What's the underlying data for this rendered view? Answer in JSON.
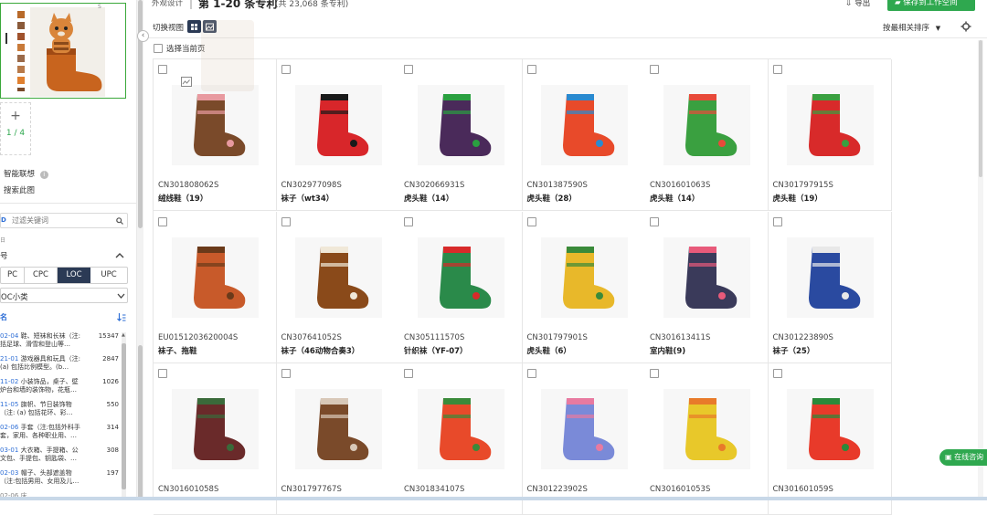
{
  "header": {
    "section": "外观设计",
    "range_title": "第 1-20 条专利",
    "total": "(共 23,068 条专利)",
    "export_label": "导出",
    "save_label": "保存到工作空间"
  },
  "toolbar": {
    "switch_view_label": "切换视图",
    "select_page_label": "选择当前页",
    "sort_label": "按最相关排序"
  },
  "left": {
    "page_indicator": "1 / 4",
    "smart_assoc_label": "智能联想",
    "search_image_label": "搜索此图",
    "filter_placeholder": "过滤关键词",
    "group_label": "号",
    "tabs": [
      "PC",
      "CPC",
      "LOC",
      "UPC"
    ],
    "active_tab": "LOC",
    "select_value": "OC小类",
    "sort_label": "名",
    "classes": [
      {
        "code": "02-04",
        "name": "鞋、短袜和长袜（注:",
        "sub": "括足球、滑雪和登山等…",
        "count": "15347"
      },
      {
        "code": "21-01",
        "name": "游戏器具和玩具（注:",
        "sub": "(a) 包括比例模型。(b…",
        "count": "2847"
      },
      {
        "code": "11-02",
        "name": "小装饰品，桌子、壁",
        "sub": "炉台和墙的装饰物，花瓶…",
        "count": "1026"
      },
      {
        "code": "11-05",
        "name": "旗帜、节日装饰物",
        "sub": "（注: (a) 包括花环、彩…",
        "count": "550"
      },
      {
        "code": "02-06",
        "name": "手套（注:包括外科手",
        "sub": "套，家用、各种职业用、…",
        "count": "314"
      },
      {
        "code": "03-01",
        "name": "大衣箱、手提箱、公",
        "sub": "文包、手提包、钥匙袋、…",
        "count": "308"
      },
      {
        "code": "02-03",
        "name": "帽子、头部遮盖物",
        "sub": "（注:包括男用、女用及儿…",
        "count": "197"
      }
    ]
  },
  "cards": [
    {
      "id": "CN301808062S",
      "name": "绒线鞋（19）",
      "color": "#7a4a2a",
      "accent": "#e89aa0"
    },
    {
      "id": "CN302977098S",
      "name": "袜子（wt34）",
      "color": "#d8262a",
      "accent": "#1a1a1a"
    },
    {
      "id": "CN302066931S",
      "name": "虎头鞋（14）",
      "color": "#4a2a5a",
      "accent": "#2aa040"
    },
    {
      "id": "CN301387590S",
      "name": "虎头鞋（28）",
      "color": "#e84a2a",
      "accent": "#2a8ad0"
    },
    {
      "id": "CN301601063S",
      "name": "虎头鞋（14）",
      "color": "#3aa040",
      "accent": "#e84a3a"
    },
    {
      "id": "CN301797915S",
      "name": "虎头鞋（19）",
      "color": "#d82a2a",
      "accent": "#3aa040"
    },
    {
      "id": "EU0151203620004S",
      "name": "袜子、拖鞋",
      "color": "#c85a2a",
      "accent": "#6a3a1a"
    },
    {
      "id": "CN307641052S",
      "name": "袜子（46动物合奏3）",
      "color": "#8a4a1a",
      "accent": "#f0e8d8"
    },
    {
      "id": "CN305111570S",
      "name": "针织袜（YF-07）",
      "color": "#2a8a4a",
      "accent": "#d82a2a"
    },
    {
      "id": "CN301797901S",
      "name": "虎头鞋（6）",
      "color": "#e8b82a",
      "accent": "#3a8a3a"
    },
    {
      "id": "CN301613411S",
      "name": "室内鞋(9)",
      "color": "#3a3a5a",
      "accent": "#e85a7a"
    },
    {
      "id": "CN301223890S",
      "name": "袜子（25）",
      "color": "#2a4aa0",
      "accent": "#e8e8e8"
    },
    {
      "id": "CN301601058S",
      "name": "",
      "color": "#6a2a2a",
      "accent": "#3a6a3a"
    },
    {
      "id": "CN301797767S",
      "name": "",
      "color": "#7a4a2a",
      "accent": "#d8c8b8"
    },
    {
      "id": "CN301834107S",
      "name": "",
      "color": "#e84a2a",
      "accent": "#3a8a3a"
    },
    {
      "id": "CN301223902S",
      "name": "",
      "color": "#7a8ad8",
      "accent": "#e87aa0"
    },
    {
      "id": "CN301601053S",
      "name": "",
      "color": "#e8c82a",
      "accent": "#e87a2a"
    },
    {
      "id": "CN301601059S",
      "name": "",
      "color": "#e83a2a",
      "accent": "#2a8a3a"
    }
  ],
  "chat": {
    "label": "在线咨询"
  },
  "colors": {
    "accent_green": "#2fa84f",
    "link_blue": "#2f6fd6",
    "loc_tab_bg": "#2b3a55"
  }
}
